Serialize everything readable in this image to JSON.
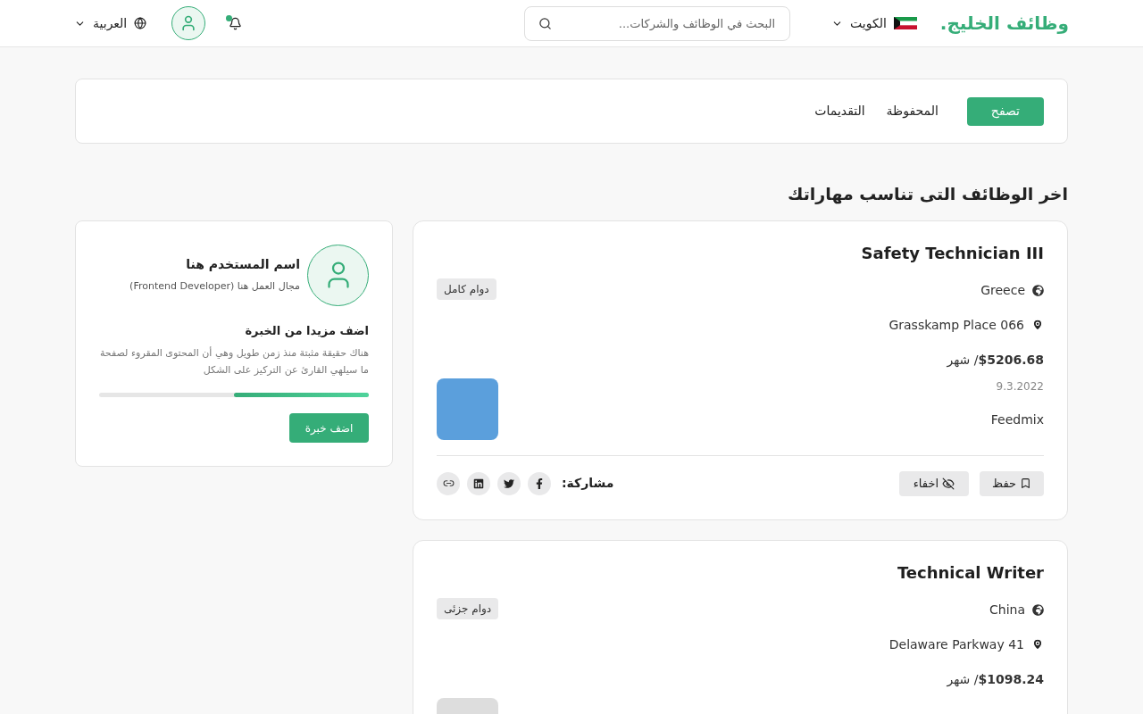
{
  "header": {
    "logo": "وظائف الخليج.",
    "country": "الكويت",
    "search": {
      "placeholder": "البحث في الوظائف والشركات..."
    },
    "notification_dot": true,
    "language": "العربية"
  },
  "tabs": [
    {
      "label": "تصفح",
      "selected": true
    },
    {
      "label": "المحفوظة",
      "selected": false
    },
    {
      "label": "التقديمات",
      "selected": false
    }
  ],
  "section_title": "اخر الوظائف التى تناسب مهاراتك",
  "jobs": [
    {
      "title": "Safety Technician III",
      "country": "Greece",
      "address": "Grasskamp Place 066",
      "salary": "$5206.68",
      "salary_unit": "/ شهر",
      "type": "دوام كامل",
      "date": "9.3.2022",
      "company": "Feedmix",
      "color": "#5b9fdc",
      "save": "حفظ",
      "hide": "اخفاء",
      "share_label": "مشاركة:"
    },
    {
      "title": "Technical Writer",
      "country": "China",
      "address": "Delaware Parkway 41",
      "salary": "$1098.24",
      "salary_unit": "/ شهر",
      "type": "دوام جزئى",
      "color": "#dddddd"
    }
  ],
  "profile": {
    "name": "اسم المستخدم هنا",
    "field": "مجال العمل هنا (Frontend Developer)",
    "prompt_title": "اضف مزيدا من الخبرة",
    "prompt_text": "هناك حقيقة مثبتة منذ زمن طويل وهي أن المحتوى المقروء لصفحة ما سيلهي القارئ عن التركيز على الشكل",
    "level": 0.5,
    "button": "اضف خبرة"
  }
}
